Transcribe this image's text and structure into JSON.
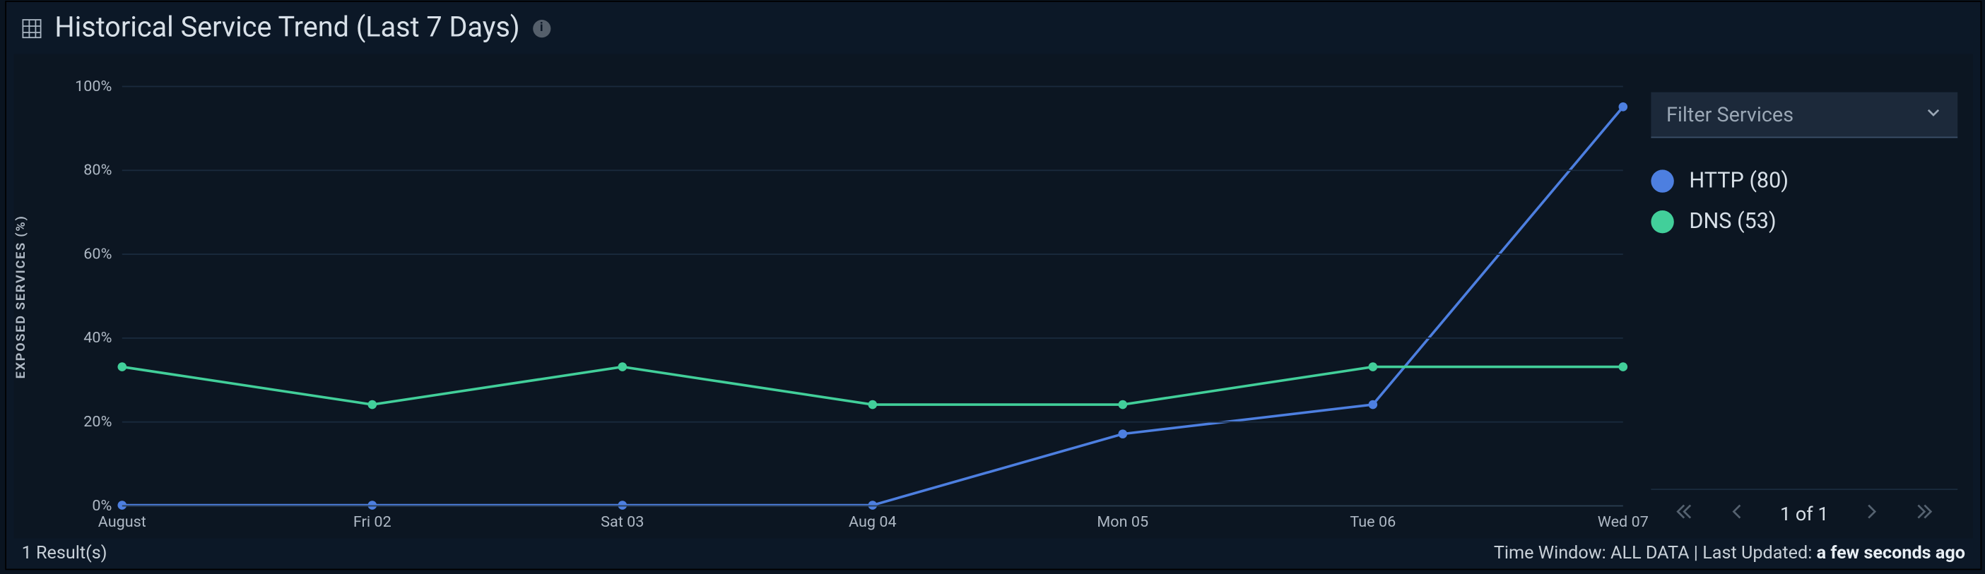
{
  "panel": {
    "title": "Historical Service Trend (Last 7 Days)"
  },
  "chart_data": {
    "type": "line",
    "title": "Historical Service Trend (Last 7 Days)",
    "ylabel": "EXPOSED SERVICES (%)",
    "xlabel": "",
    "ylim": [
      0,
      100
    ],
    "yticks": [
      "0%",
      "20%",
      "40%",
      "60%",
      "80%",
      "100%"
    ],
    "categories": [
      "August",
      "Fri 02",
      "Sat 03",
      "Aug 04",
      "Mon 05",
      "Tue 06",
      "Wed 07"
    ],
    "series": [
      {
        "name": "HTTP (80)",
        "color": "#4d7fe0",
        "values": [
          0,
          0,
          0,
          0,
          17,
          24,
          95
        ]
      },
      {
        "name": "DNS (53)",
        "color": "#42cf9a",
        "values": [
          33,
          24,
          33,
          24,
          24,
          33,
          33
        ]
      }
    ]
  },
  "filter": {
    "label": "Filter Services"
  },
  "pager": {
    "text": "1 of 1"
  },
  "footer": {
    "results": "1 Result(s)",
    "time_window_label": "Time Window: ",
    "time_window_value": "ALL DATA",
    "separator": " | ",
    "updated_label": "Last Updated: ",
    "updated_value": "a few seconds ago"
  }
}
